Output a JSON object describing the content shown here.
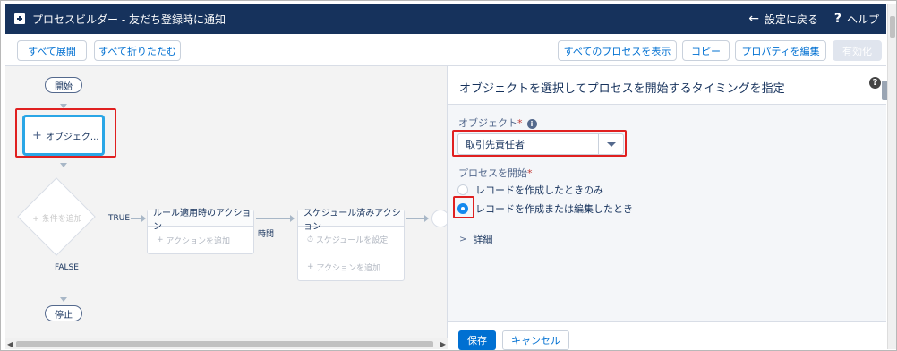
{
  "header": {
    "title": "プロセスビルダー - 友だち登録時に通知",
    "back_label": "設定に戻る",
    "help_label": "ヘルプ"
  },
  "toolbar": {
    "expand_all": "すべて展開",
    "collapse_all": "すべて折りたたむ",
    "view_all_processes": "すべてのプロセスを表示",
    "copy": "コピー",
    "edit_properties": "プロパティを編集",
    "activate": "有効化"
  },
  "canvas": {
    "start_label": "開始",
    "object_node_label": "オブジェク...",
    "add_criteria": "条件を追加",
    "true_label": "TRUE",
    "false_label": "FALSE",
    "stop_label": "停止",
    "immediate_actions_title": "ルール適用時のアクション",
    "add_action": "アクションを追加",
    "time_label": "時間",
    "scheduled_actions_title": "スケジュール済みアクション",
    "set_schedule": "スケジュールを設定",
    "add_action_scheduled": "アクションを追加"
  },
  "panel": {
    "title": "オブジェクトを選択してプロセスを開始するタイミングを指定",
    "object_label": "オブジェクト",
    "required_mark": "*",
    "object_value": "取引先責任者",
    "start_process_label": "プロセスを開始",
    "options": [
      {
        "label": "レコードを作成したときのみ",
        "checked": false
      },
      {
        "label": "レコードを作成または編集したとき",
        "checked": true
      }
    ],
    "details_label": "詳細",
    "save": "保存",
    "cancel": "キャンセル"
  },
  "colors": {
    "header_bg": "#16325c",
    "accent": "#0070d2",
    "highlight": "#e02020",
    "selected_node_border": "#2aa6e6"
  }
}
